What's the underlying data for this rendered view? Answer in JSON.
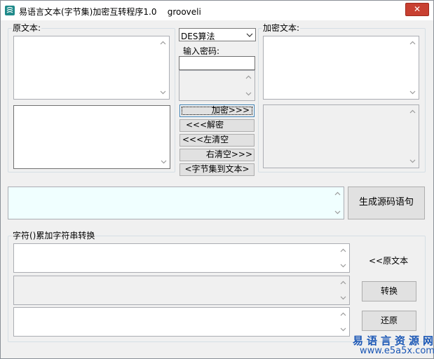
{
  "window": {
    "title": "易语言文本(字节集)加密互转程序1.0    grooveli",
    "close_glyph": "✕"
  },
  "source_group": {
    "label": "原文本:"
  },
  "middle": {
    "algorithm_select": {
      "value": "DES算法"
    },
    "password_label": "输入密码:",
    "password_value": "",
    "buttons": {
      "encrypt": "加密>>>",
      "decrypt": "<<<解密",
      "clear_left": "<<<左清空",
      "clear_right": "右清空>>>",
      "bytes_to_text": "<字节集到文本>"
    }
  },
  "encrypted_group": {
    "label": "加密文本:"
  },
  "code_section": {
    "generate_button": "生成源码语句"
  },
  "convert_group": {
    "label": "字符()累加字符串转换",
    "original_text_label": "<<原文本",
    "convert_button": "转换",
    "restore_button": "还原"
  },
  "watermark": {
    "title": "易语言资源网",
    "url": "www.e5a5x.com"
  },
  "colors": {
    "accent_watermark": "#1b57b5",
    "close_red": "#c84031",
    "cyan_box": "#f0ffff"
  },
  "icons": {
    "app": "app-icon",
    "scroll_up": "chevron-up-icon",
    "scroll_down": "chevron-down-icon",
    "dropdown": "chevron-down-icon"
  }
}
